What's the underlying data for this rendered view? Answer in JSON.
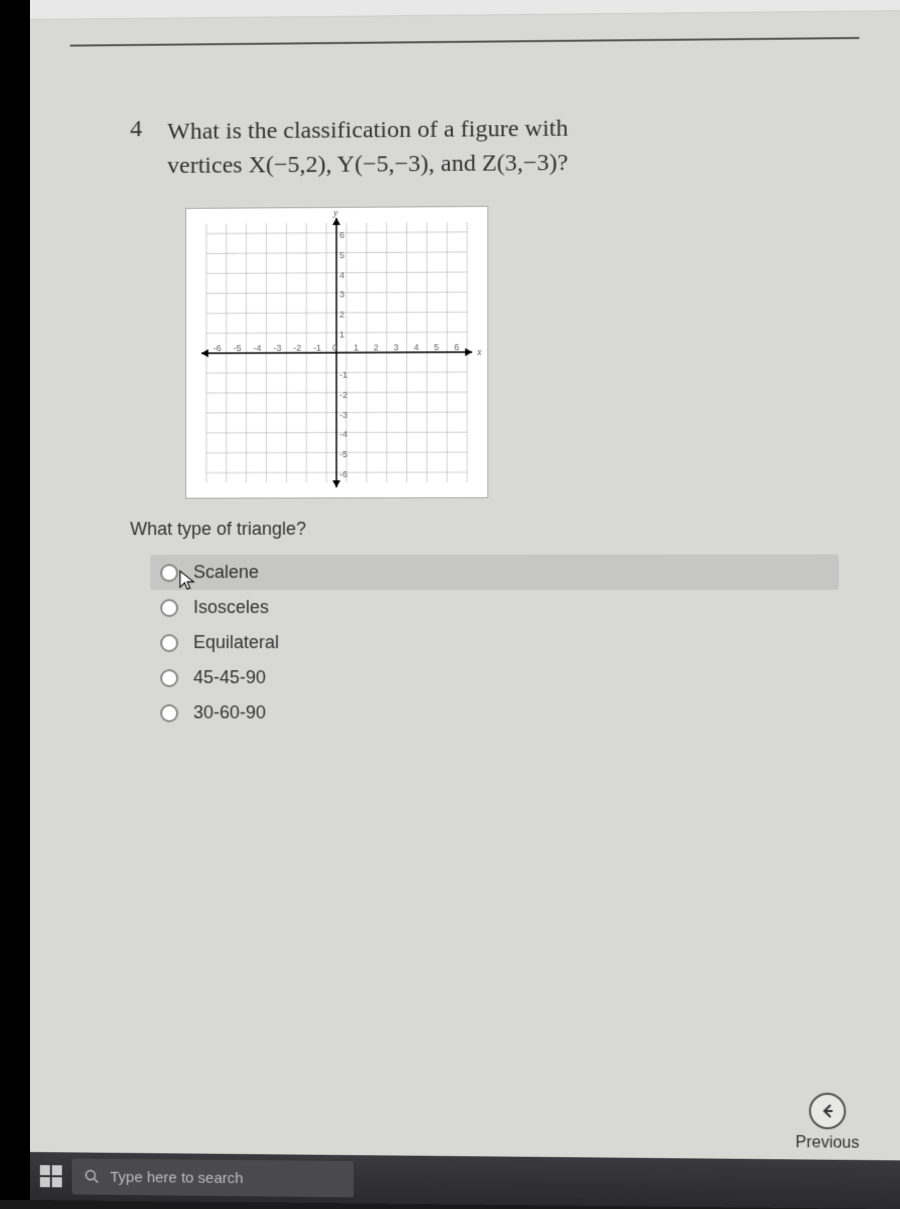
{
  "question": {
    "number": "4",
    "text_line1": "What is the classification of a figure with",
    "text_line2": "vertices X(−5,2), Y(−5,−3), and Z(3,−3)?"
  },
  "graph": {
    "x_ticks": [
      "-6",
      "-5",
      "-4",
      "-3",
      "-2",
      "-1",
      "0",
      "1",
      "2",
      "3",
      "4",
      "5",
      "6"
    ],
    "y_ticks": [
      "6",
      "5",
      "4",
      "3",
      "2",
      "1",
      "-1",
      "-2",
      "-3",
      "-4",
      "-5",
      "-6"
    ],
    "x_label": "x",
    "y_label": "y"
  },
  "sub_question": "What type of triangle?",
  "options": [
    {
      "label": "Scalene",
      "hover": true
    },
    {
      "label": "Isosceles",
      "hover": false
    },
    {
      "label": "Equilateral",
      "hover": false
    },
    {
      "label": "45-45-90",
      "hover": false
    },
    {
      "label": "30-60-90",
      "hover": false
    }
  ],
  "nav": {
    "prev_label": "Previous"
  },
  "taskbar": {
    "search_placeholder": "Type here to search"
  }
}
